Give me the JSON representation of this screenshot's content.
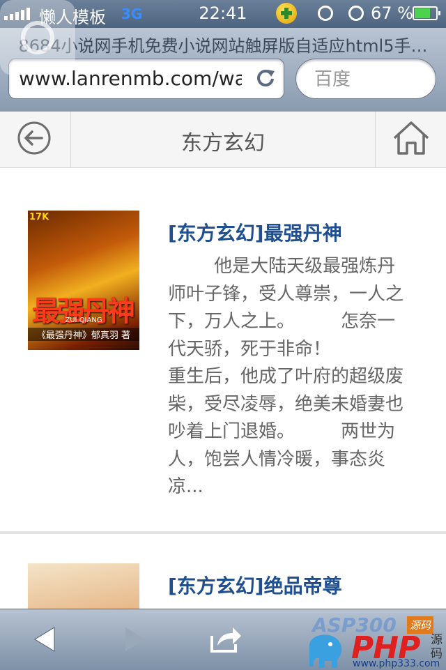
{
  "status_bar": {
    "carrier": "懒人模板",
    "network": "3G",
    "time": "22:41",
    "battery": "67 %"
  },
  "browser": {
    "page_title": "8684小说网手机免费小说网站触屏版自适应html5手…",
    "url": "www.lanrenmb.com/wap",
    "search_placeholder": "百度"
  },
  "site": {
    "title": "东方玄幻"
  },
  "books": [
    {
      "title": "[东方玄幻]最强丹神",
      "cover_title": "最强丹神",
      "cover_pinyin": "ZUI QIANG",
      "cover_author": "《最强丹神》郁真羽 著",
      "cover_tag": "17K",
      "description": "        他是大陆天级最强炼丹师叶子锋，受人尊崇，一人之下，万人之上。        怎奈一代天骄，死于非命！\n重生后，他成了叶府的超级废柴，受尽凌辱，绝美未婚妻也吵着上门退婚。        两世为人，饱尝人情冷暖，事态炎凉..."
    },
    {
      "title": "[东方玄幻]绝品帝尊"
    }
  ],
  "watermark": {
    "top_text": "ASP300",
    "top_tag": "源码",
    "brand": "PHP",
    "brand_tag": "源码",
    "url": "www.php333.com"
  },
  "colors": {
    "title_blue": "#1f4f8f",
    "desc_gray": "#666666",
    "header_bg": "#f5f5f5"
  }
}
